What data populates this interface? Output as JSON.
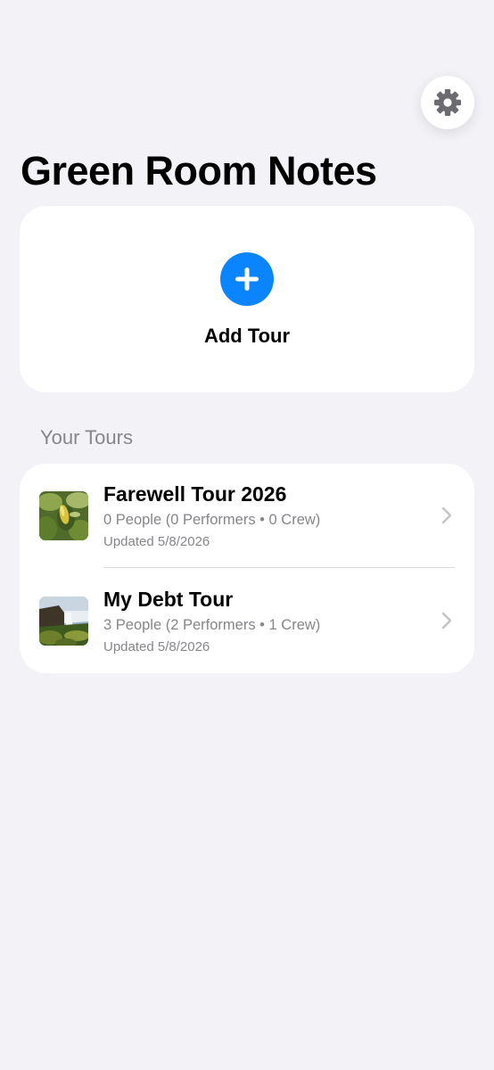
{
  "header": {
    "title": "Green Room Notes",
    "settings_icon": "gear-icon"
  },
  "add_tour": {
    "label": "Add Tour",
    "icon": "plus-icon",
    "accent_color": "#0a84ff"
  },
  "tours_section": {
    "header": "Your Tours",
    "items": [
      {
        "title": "Farewell Tour 2026",
        "people": "0 People (0 Performers • 0 Crew)",
        "updated": "Updated 5/8/2026",
        "thumbnail": "leaves-photo"
      },
      {
        "title": "My Debt Tour",
        "people": "3 People (2 Performers • 1 Crew)",
        "updated": "Updated 5/8/2026",
        "thumbnail": "waterfall-photo"
      }
    ]
  }
}
